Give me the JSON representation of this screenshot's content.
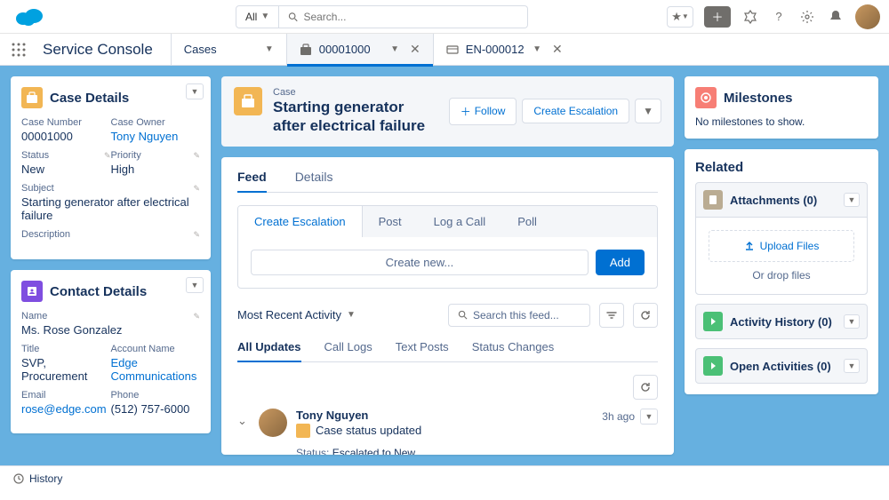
{
  "header": {
    "search_scope": "All",
    "search_placeholder": "Search..."
  },
  "nav": {
    "app_name": "Service Console",
    "tabs": [
      {
        "label": "Cases",
        "active": false,
        "closeable": false
      },
      {
        "label": "00001000",
        "active": true,
        "closeable": true,
        "icon": "case"
      },
      {
        "label": "EN-000012",
        "active": false,
        "closeable": true,
        "icon": "entitlement"
      }
    ]
  },
  "case_details": {
    "title": "Case Details",
    "case_number_label": "Case Number",
    "case_number": "00001000",
    "case_owner_label": "Case Owner",
    "case_owner": "Tony Nguyen",
    "status_label": "Status",
    "status": "New",
    "priority_label": "Priority",
    "priority": "High",
    "subject_label": "Subject",
    "subject": "Starting generator after electrical failure",
    "description_label": "Description"
  },
  "contact_details": {
    "title": "Contact Details",
    "name_label": "Name",
    "name": "Ms. Rose Gonzalez",
    "title_label": "Title",
    "title_val": "SVP, Procurement",
    "account_label": "Account Name",
    "account": "Edge Communications",
    "email_label": "Email",
    "email": "rose@edge.com",
    "phone_label": "Phone",
    "phone": "(512) 757-6000"
  },
  "record": {
    "type": "Case",
    "title": "Starting generator after electrical failure",
    "follow_label": "Follow",
    "escalation_label": "Create Escalation"
  },
  "mid_tabs": {
    "feed": "Feed",
    "details": "Details"
  },
  "composer": {
    "tabs": [
      "Create Escalation",
      "Post",
      "Log a Call",
      "Poll"
    ],
    "placeholder": "Create new...",
    "add": "Add"
  },
  "feed": {
    "sort": "Most Recent Activity",
    "search_placeholder": "Search this feed...",
    "filters": [
      "All Updates",
      "Call Logs",
      "Text Posts",
      "Status Changes"
    ],
    "item": {
      "author": "Tony Nguyen",
      "action": "Case status updated",
      "time": "3h ago",
      "status_field": "Status:",
      "status_value": "Escalated to New"
    }
  },
  "milestones": {
    "title": "Milestones",
    "empty": "No milestones to show."
  },
  "related": {
    "title": "Related",
    "attachments": "Attachments (0)",
    "upload": "Upload Files",
    "drop": "Or drop files",
    "activity_history": "Activity History (0)",
    "open_activities": "Open Activities (0)"
  },
  "footer": {
    "history": "History"
  },
  "colors": {
    "case_icon": "#f2b654",
    "contact_icon": "#7f4ee0",
    "milestone_icon": "#f77e75",
    "attachment_icon": "#baac93",
    "activity_icon": "#4bc076"
  }
}
